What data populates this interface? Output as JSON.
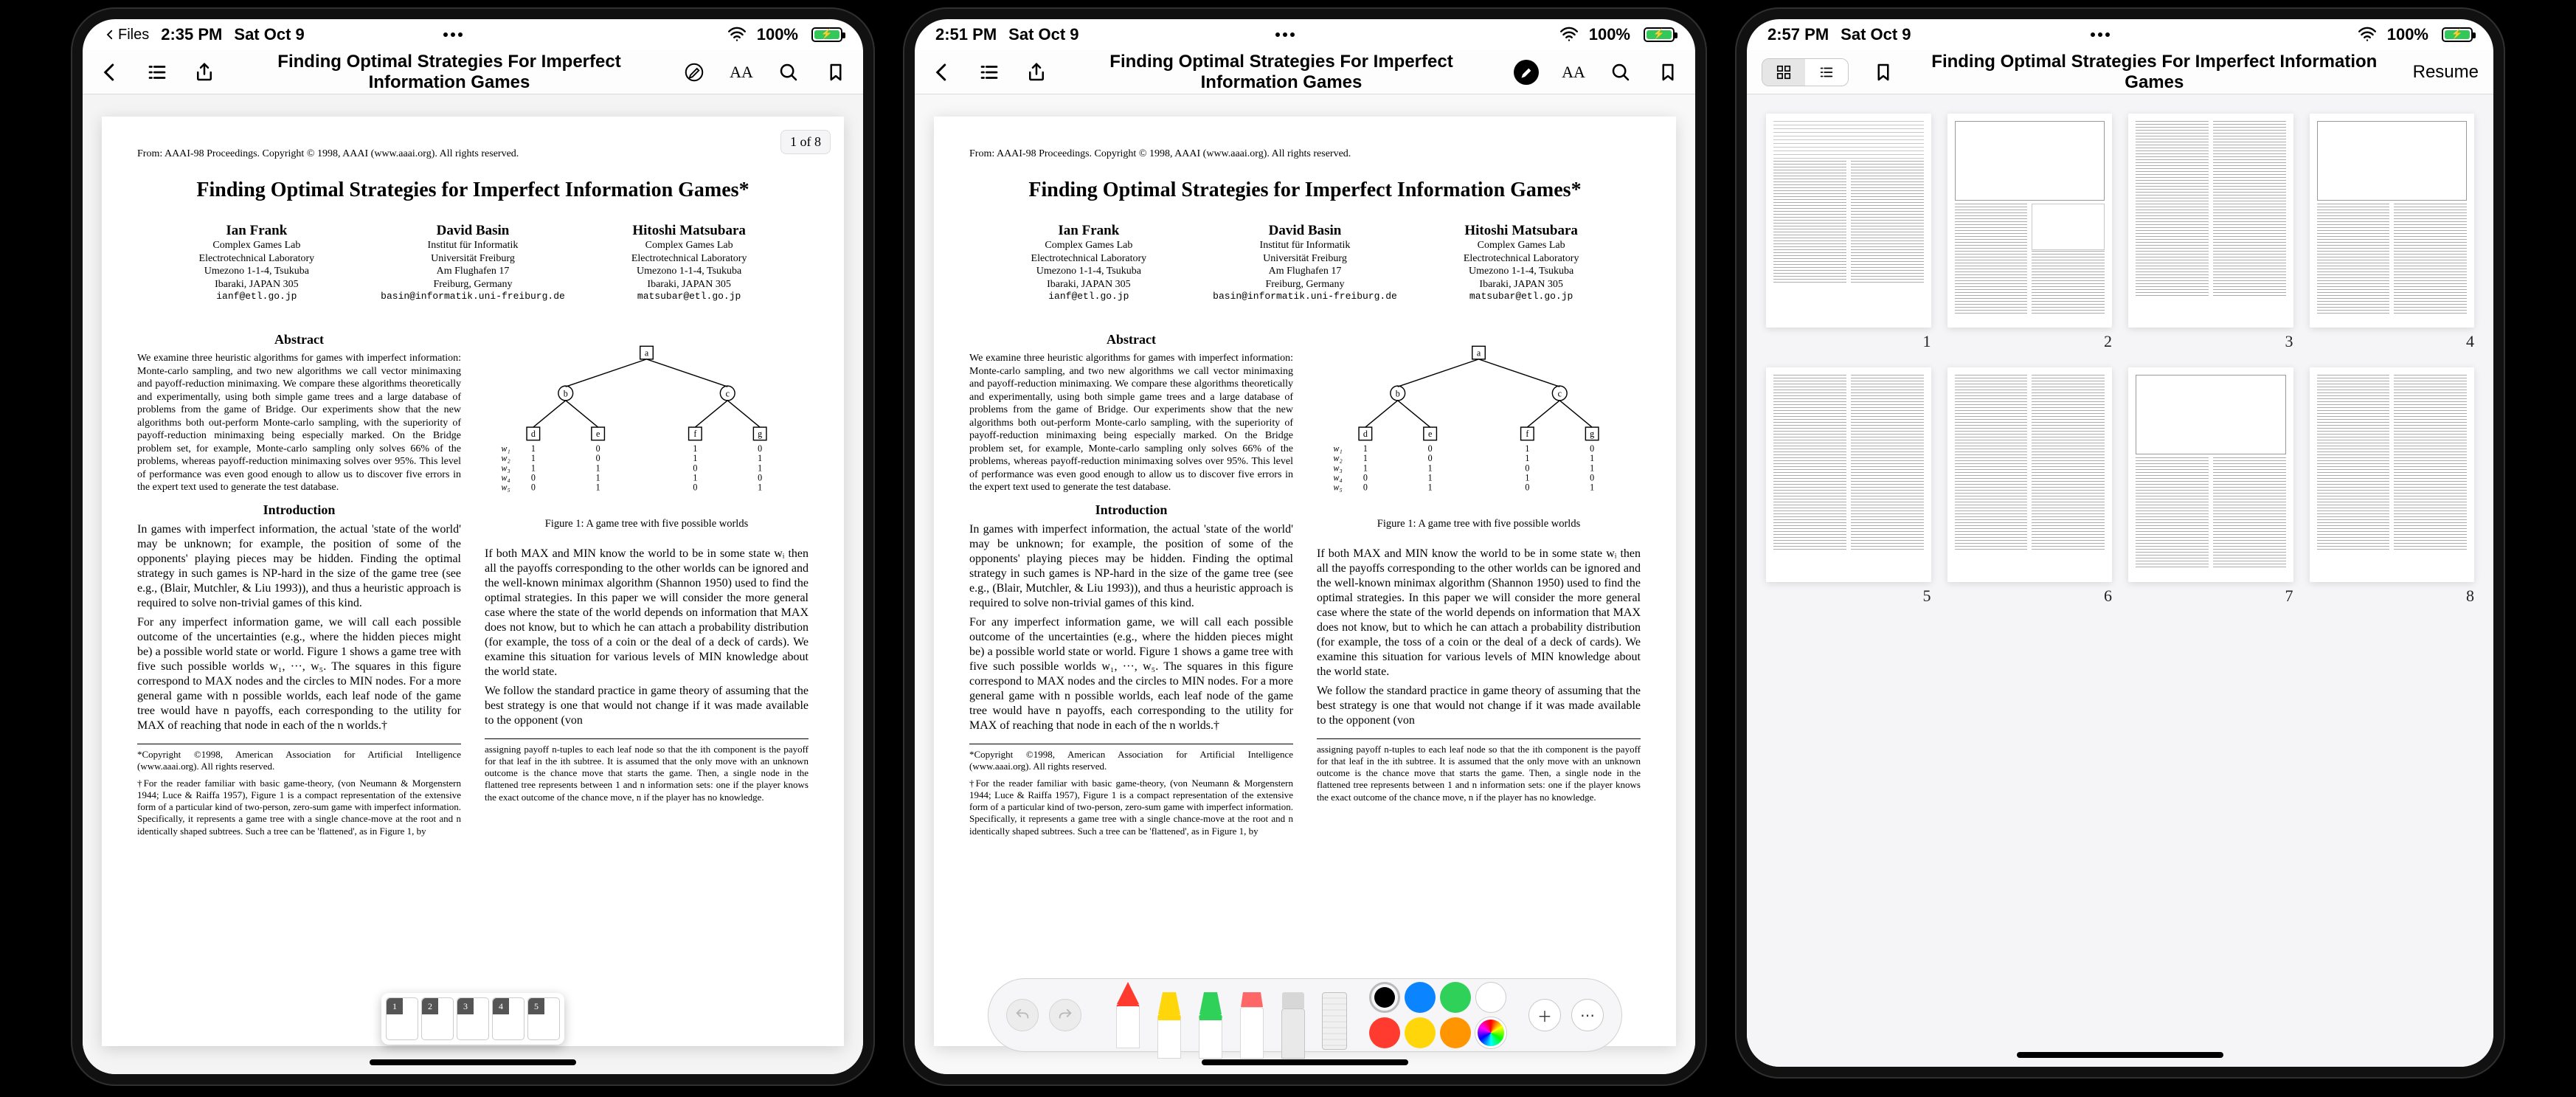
{
  "devices": [
    {
      "statusbar": {
        "back_app": "Files",
        "time": "2:35 PM",
        "date": "Sat Oct 9",
        "battery_pct": "100%"
      },
      "toolbar": {
        "title": "Finding Optimal Strategies For Imperfect Information Games"
      },
      "page_indicator": "1 of 8"
    },
    {
      "statusbar": {
        "time": "2:51 PM",
        "date": "Sat Oct 9",
        "battery_pct": "100%"
      },
      "toolbar": {
        "title": "Finding Optimal Strategies For Imperfect Information Games"
      }
    },
    {
      "statusbar": {
        "time": "2:57 PM",
        "date": "Sat Oct 9",
        "battery_pct": "100%"
      },
      "toolbar": {
        "title": "Finding Optimal Strategies For Imperfect Information Games",
        "resume": "Resume"
      },
      "page_count": 8
    }
  ],
  "doc": {
    "proceedings_line": "From: AAAI-98 Proceedings. Copyright © 1998, AAAI (www.aaai.org). All rights reserved.",
    "title": "Finding Optimal Strategies for Imperfect Information Games*",
    "authors": [
      {
        "name": "Ian Frank",
        "lines": [
          "Complex Games Lab",
          "Electrotechnical Laboratory",
          "Umezono 1-1-4, Tsukuba",
          "Ibaraki, JAPAN 305"
        ],
        "email": "ianf@etl.go.jp"
      },
      {
        "name": "David Basin",
        "lines": [
          "Institut für Informatik",
          "Universität Freiburg",
          "Am Flughafen 17",
          "Freiburg, Germany"
        ],
        "email": "basin@informatik.uni-freiburg.de"
      },
      {
        "name": "Hitoshi Matsubara",
        "lines": [
          "Complex Games Lab",
          "Electrotechnical Laboratory",
          "Umezono 1-1-4, Tsukuba",
          "Ibaraki, JAPAN 305"
        ],
        "email": "matsubar@etl.go.jp"
      }
    ],
    "abstract_heading": "Abstract",
    "abstract": "We examine three heuristic algorithms for games with imperfect information: Monte-carlo sampling, and two new algorithms we call vector minimaxing and payoff-reduction minimaxing. We compare these algorithms theoretically and experimentally, using both simple game trees and a large database of problems from the game of Bridge. Our experiments show that the new algorithms both out-perform Monte-carlo sampling, with the superiority of payoff-reduction minimaxing being especially marked. On the Bridge problem set, for example, Monte-carlo sampling only solves 66% of the problems, whereas payoff-reduction minimaxing solves over 95%. This level of performance was even good enough to allow us to discover five errors in the expert text used to generate the test database.",
    "intro_heading": "Introduction",
    "intro_p1": "In games with imperfect information, the actual 'state of the world' may be unknown; for example, the position of some of the opponents' playing pieces may be hidden. Finding the optimal strategy in such games is NP-hard in the size of the game tree (see e.g., (Blair, Mutchler, & Liu 1993)), and thus a heuristic approach is required to solve non-trivial games of this kind.",
    "intro_p2": "For any imperfect information game, we will call each possible outcome of the uncertainties (e.g., where the hidden pieces might be) a possible world state or world. Figure 1 shows a game tree with five such possible worlds w₁, ···, w₅. The squares in this figure correspond to MAX nodes and the circles to MIN nodes. For a more general game with n possible worlds, each leaf node of the game tree would have n payoffs, each corresponding to the utility for MAX of reaching that node in each of the n worlds.†",
    "fn_copyright": "*Copyright ©1998, American Association for Artificial Intelligence (www.aaai.org). All rights reserved.",
    "fn_reader": "†For the reader familiar with basic game-theory, (von Neumann & Morgenstern 1944; Luce & Raiffa 1957), Figure 1 is a compact representation of the extensive form of a particular kind of two-person, zero-sum game with imperfect information. Specifically, it represents a game tree with a single chance-move at the root and n identically shaped subtrees. Such a tree can be 'flattened', as in Figure 1, by",
    "figure_caption": "Figure 1: A game tree with five possible worlds",
    "right_p1": "If both MAX and MIN know the world to be in some state wᵢ then all the payoffs corresponding to the other worlds can be ignored and the well-known minimax algorithm (Shannon 1950) used to find the optimal strategies. In this paper we will consider the more general case where the state of the world depends on information that MAX does not know, but to which he can attach a probability distribution (for example, the toss of a coin or the deal of a deck of cards). We examine this situation for various levels of MIN knowledge about the world state.",
    "right_p2": "We follow the standard practice in game theory of assuming that the best strategy is one that would not change if it was made available to the opponent (von",
    "right_p3": "assigning payoff n-tuples to each leaf node so that the ith component is the payoff for that leaf in the ith subtree. It is assumed that the only move with an unknown outcome is the chance move that starts the game. Then, a single node in the flattened tree represents between 1 and n information sets: one if the player knows the exact outcome of the chance move, n if the player has no knowledge."
  },
  "markup": {
    "tool_names": [
      "pen",
      "marker-yellow",
      "marker-green",
      "pencil",
      "eraser",
      "selection",
      "ruler"
    ],
    "swatch_colors": [
      "#000000",
      "#0a84ff",
      "#30d158",
      "#ffffff",
      "#ff3b30",
      "#ffd60a",
      "#ff9500",
      "conic"
    ]
  }
}
